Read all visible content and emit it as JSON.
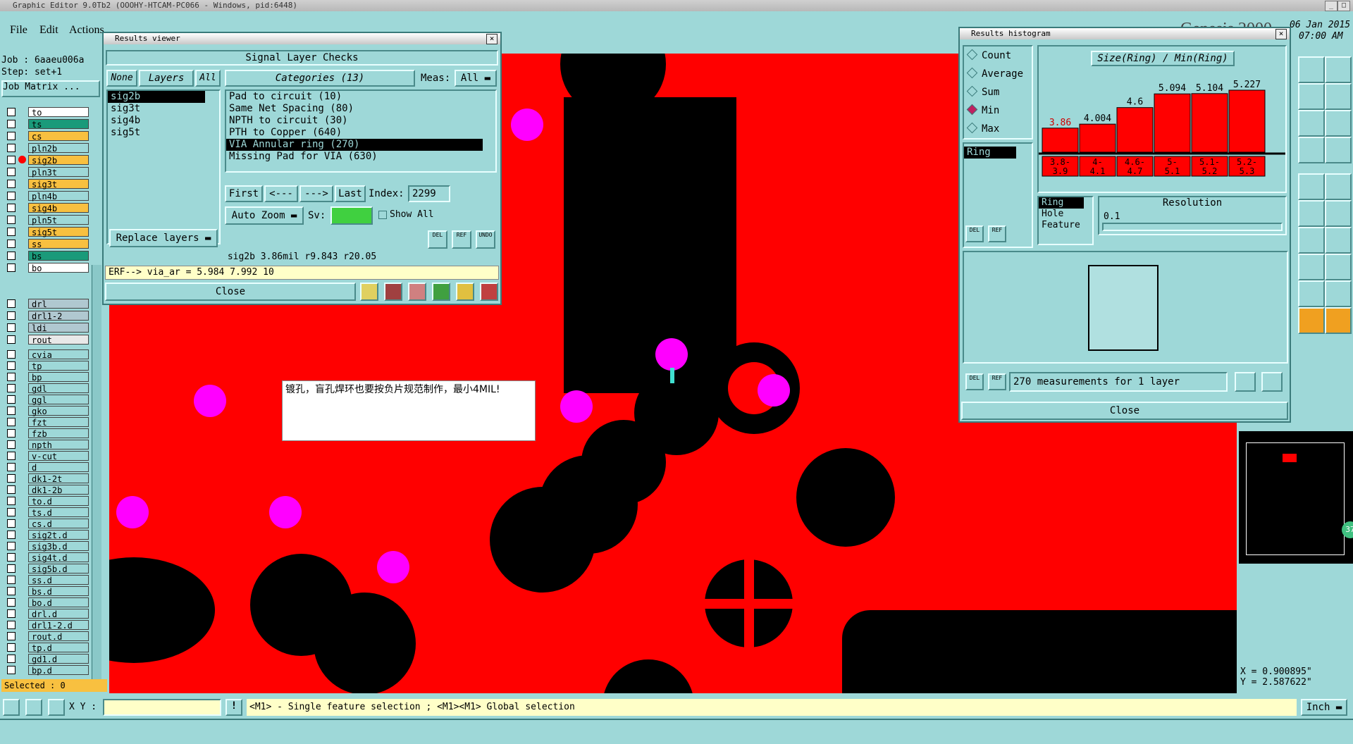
{
  "titlebar": {
    "text": "Graphic Editor 9.0Tb2 (OOOHY-HTCAM-PC066 - Windows, pid:6448)"
  },
  "menu": {
    "file": "File",
    "edit": "Edit",
    "actions": "Actions"
  },
  "brand": {
    "name": "Genesis 2000",
    "date": "06 Jan 2015",
    "time": "07:00 AM"
  },
  "job": {
    "job": "Job : 6aaeu006a",
    "step": "Step: set+1",
    "matrix": "Job Matrix ..."
  },
  "layers_top": [
    {
      "name": "to",
      "color": "#ffffff",
      "mark": false
    },
    {
      "name": "ts",
      "color": "#1a9a7a",
      "mark": false
    },
    {
      "name": "cs",
      "color": "#f8c040",
      "mark": false
    },
    {
      "name": "pln2b",
      "color": "#9ed8d8",
      "mark": false
    },
    {
      "name": "sig2b",
      "color": "#f8c040",
      "mark": true
    },
    {
      "name": "pln3t",
      "color": "#9ed8d8",
      "mark": false
    },
    {
      "name": "sig3t",
      "color": "#f8c040",
      "mark": false
    },
    {
      "name": "pln4b",
      "color": "#9ed8d8",
      "mark": false
    },
    {
      "name": "sig4b",
      "color": "#f8c040",
      "mark": false
    },
    {
      "name": "pln5t",
      "color": "#9ed8d8",
      "mark": false
    },
    {
      "name": "sig5t",
      "color": "#f8c040",
      "mark": false
    },
    {
      "name": "ss",
      "color": "#f8c040",
      "mark": false
    },
    {
      "name": "bs",
      "color": "#1a9a7a",
      "mark": false
    },
    {
      "name": "bo",
      "color": "#ffffff",
      "mark": false
    }
  ],
  "layers_drill": [
    {
      "name": "drl",
      "color": "#b0c8d0"
    },
    {
      "name": "drl1-2",
      "color": "#b0c8d0"
    },
    {
      "name": "ldi",
      "color": "#b0c8d0"
    },
    {
      "name": "rout",
      "color": "#e8e8e8"
    }
  ],
  "layers_misc": [
    "cvia",
    "tp",
    "bp",
    "gdl",
    "ggl",
    "gko",
    "fzt",
    "fzb",
    "npth",
    "v-cut",
    "d",
    "dk1-2t",
    "dk1-2b",
    "to.d",
    "ts.d",
    "cs.d",
    "sig2t.d",
    "sig3b.d",
    "sig4t.d",
    "sig5b.d",
    "ss.d",
    "bs.d",
    "bo.d",
    "drl.d",
    "drl1-2.d",
    "rout.d",
    "tp.d",
    "gd1.d",
    "bp.d"
  ],
  "selected_count": "Selected : 0",
  "results_viewer": {
    "title": "Results viewer",
    "header": "Signal Layer Checks",
    "tab_none": "None",
    "tab_layers": "Layers",
    "tab_all": "All",
    "categories_label": "Categories (13)",
    "meas_label": "Meas:",
    "meas_value": "All",
    "layers": [
      "sig2b",
      "sig3t",
      "sig4b",
      "sig5t"
    ],
    "categories": [
      "Pad to circuit (10)",
      "Same Net Spacing (80)",
      "NPTH to circuit (30)",
      "PTH to Copper (640)",
      "VIA Annular ring (270)",
      "Missing Pad for VIA (630)"
    ],
    "nav_first": "First",
    "nav_prev": "<---",
    "nav_next": "--->",
    "nav_last": "Last",
    "index_label": "Index:",
    "index_value": "2299",
    "auto_zoom": "Auto Zoom",
    "sv_label": "Sv:",
    "show_all": "Show All",
    "replace_layers": "Replace layers",
    "del": "DEL",
    "ref": "REF",
    "undo": "UNDO",
    "info_line": "sig2b 3.86mil  r9.843  r20.05",
    "erf_line": "ERF--> via_ar = 5.984 7.992 10",
    "close": "Close"
  },
  "histogram": {
    "title": "Results histogram",
    "modes": [
      "Count",
      "Average",
      "Sum",
      "Min",
      "Max"
    ],
    "active_mode": "Min",
    "list_item": "Ring",
    "chart_title": "Size(Ring) / Min(Ring)",
    "del": "DEL",
    "ref": "REF",
    "sort_opts": [
      "Ring",
      "Hole",
      "Feature"
    ],
    "resolution_label": "Resolution",
    "resolution_value": "0.1",
    "measurements": "270 measurements for 1 layer",
    "close": "Close"
  },
  "chart_data": {
    "type": "bar",
    "title": "Size(Ring) / Min(Ring)",
    "categories": [
      "3.8-3.9",
      "4-4.1",
      "4.6-4.7",
      "5-5.1",
      "5.1-5.2",
      "5.2-5.3"
    ],
    "values": [
      3.86,
      4.004,
      4.6,
      5.094,
      5.104,
      5.227
    ],
    "highlight_color": "#ff0000",
    "bar_color": "#ff0000"
  },
  "canvas": {
    "note": "镀孔，盲孔焊环也要按负片规范制作，最小4MIL!"
  },
  "coords": {
    "x": "X = 0.900895\"",
    "y": "Y = 2.587622\""
  },
  "status": {
    "xy_label": "X Y :",
    "xy_value": "",
    "hint": "<M1> - Single feature selection ; <M1><M1> Global selection",
    "units": "Inch"
  },
  "mini_badge": "37"
}
